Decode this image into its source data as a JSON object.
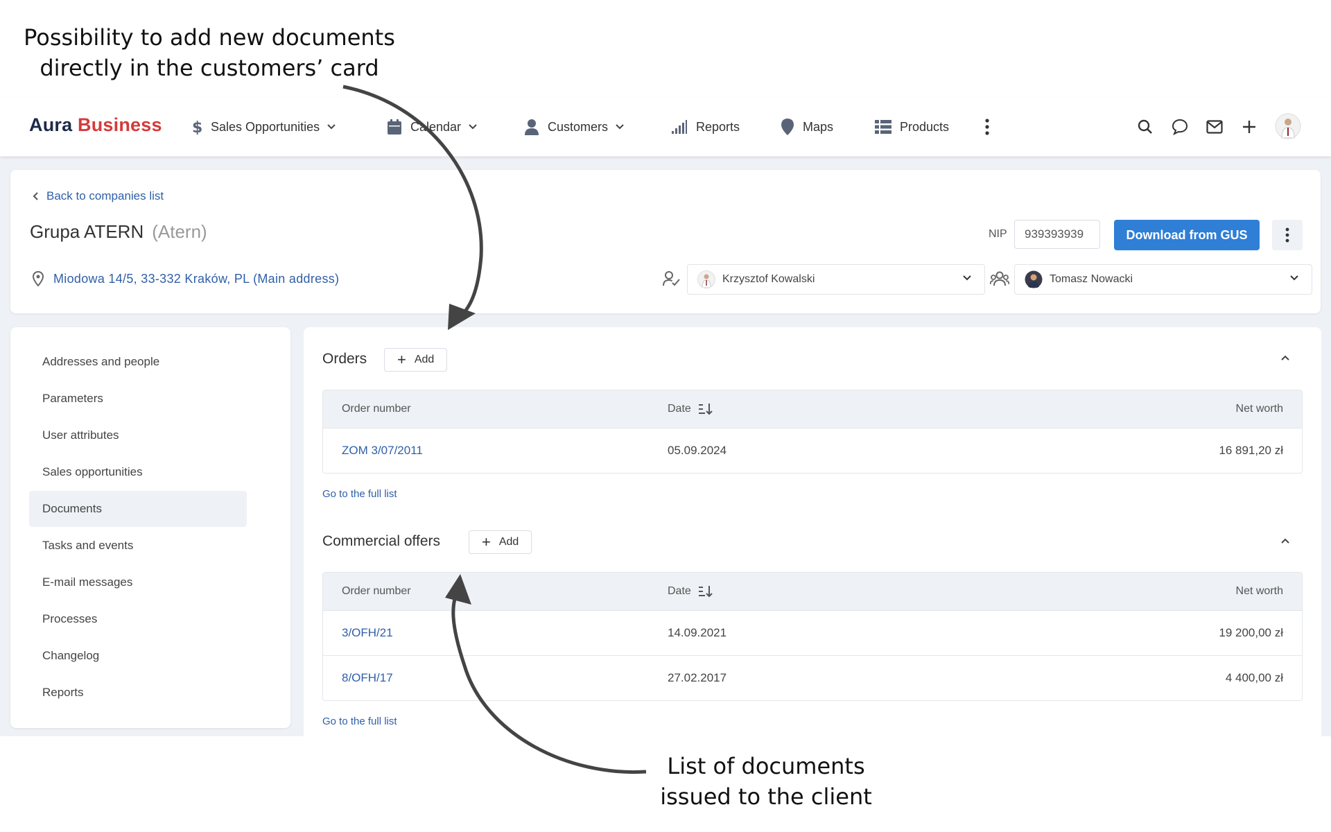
{
  "annotations": {
    "top_line1": "Possibility to add new documents",
    "top_line2": "directly in the customers’ card",
    "bottom_line1": "List of documents",
    "bottom_line2": "issued to the client"
  },
  "nav": {
    "logo_part1": "Aura",
    "logo_part2": "Business",
    "items": [
      {
        "label": "Sales Opportunities",
        "icon": "dollar-icon"
      },
      {
        "label": "Calendar",
        "icon": "calendar-icon"
      },
      {
        "label": "Customers",
        "icon": "person-icon"
      },
      {
        "label": "Reports",
        "icon": "bar-chart-icon"
      },
      {
        "label": "Maps",
        "icon": "map-pin-icon"
      },
      {
        "label": "Products",
        "icon": "list-icon"
      }
    ]
  },
  "header": {
    "back_label": "Back to companies list",
    "company_name": "Grupa ATERN",
    "company_short": "(Atern)",
    "address": "Miodowa 14/5, 33-332 Kraków, PL (Main address)",
    "nip_label": "NIP",
    "nip_value": "939393939",
    "gus_button": "Download from GUS",
    "owner": "Krzysztof Kowalski",
    "team_member": "Tomasz Nowacki"
  },
  "sidebar": {
    "items": [
      "Addresses and people",
      "Parameters",
      "User attributes",
      "Sales opportunities",
      "Documents",
      "Tasks and events",
      "E-mail messages",
      "Processes",
      "Changelog",
      "Reports"
    ],
    "active": "Documents"
  },
  "orders": {
    "title": "Orders",
    "add_label": "Add",
    "columns": [
      "Order number",
      "Date",
      "Net worth"
    ],
    "rows": [
      {
        "number": "ZOM 3/07/2011",
        "date": "05.09.2024",
        "net": "16 891,20 zł"
      }
    ],
    "full_list": "Go to the full list"
  },
  "offers": {
    "title": "Commercial offers",
    "add_label": "Add",
    "columns": [
      "Order number",
      "Date",
      "Net worth"
    ],
    "rows": [
      {
        "number": "3/OFH/21",
        "date": "14.09.2021",
        "net": "19 200,00 zł"
      },
      {
        "number": "8/OFH/17",
        "date": "27.02.2017",
        "net": "4 400,00 zł"
      }
    ],
    "full_list": "Go to the full list"
  },
  "colors": {
    "brand_dark": "#1c2a4a",
    "brand_red": "#d63a3a",
    "primary_button": "#2f7fd6",
    "link": "#2f5fa8",
    "panel_bg": "#eef1f5"
  }
}
